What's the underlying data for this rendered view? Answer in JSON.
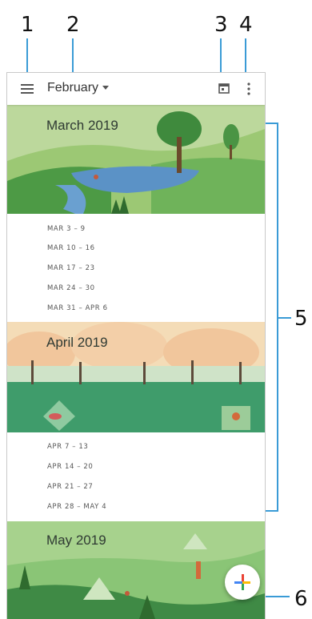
{
  "callouts": [
    "1",
    "2",
    "3",
    "4",
    "5",
    "6"
  ],
  "app_bar": {
    "month_label": "February",
    "menu_icon": "menu-icon",
    "today_icon": "calendar-today-icon",
    "overflow_icon": "more-vert-icon"
  },
  "months": [
    {
      "title": "March 2019",
      "weeks": [
        "MAR 3 – 9",
        "MAR 10 – 16",
        "MAR 17 – 23",
        "MAR 24 – 30",
        "MAR 31 – APR 6"
      ]
    },
    {
      "title": "April 2019",
      "weeks": [
        "APR 7 – 13",
        "APR 14 – 20",
        "APR 21 – 27",
        "APR 28 – MAY 4"
      ]
    },
    {
      "title": "May 2019",
      "weeks": []
    }
  ],
  "fab": {
    "icon": "plus-icon",
    "colors": [
      "#4285f4",
      "#ea4335",
      "#fbbc05",
      "#34a853"
    ]
  },
  "colors": {
    "callout_line": "#3a9bd6"
  }
}
